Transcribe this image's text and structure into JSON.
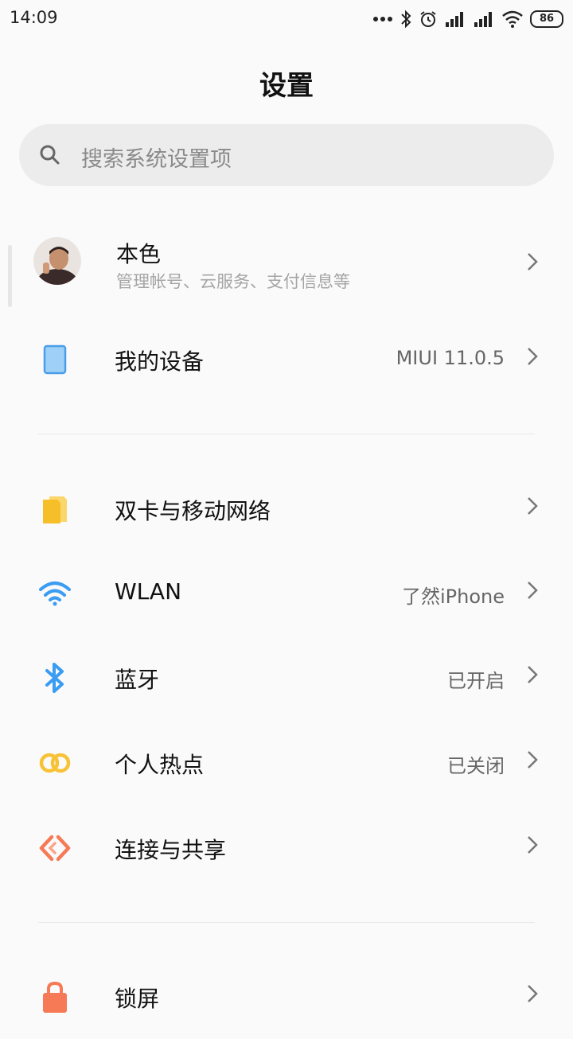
{
  "status_bar": {
    "time": "14:09",
    "icons": [
      "more-dots-icon",
      "bluetooth-icon",
      "alarm-icon",
      "signal-icon",
      "signal-icon",
      "wifi-icon"
    ],
    "battery": "86"
  },
  "page": {
    "title": "设置"
  },
  "search": {
    "placeholder": "搜索系统设置项"
  },
  "account": {
    "name": "本色",
    "subtitle": "管理帐号、云服务、支付信息等"
  },
  "sections": [
    {
      "items": [
        {
          "label": "我的设备",
          "value": "MIUI 11.0.5",
          "icon": "tablet-icon",
          "icon_color": "#5aaef0"
        }
      ]
    },
    {
      "items": [
        {
          "label": "双卡与移动网络",
          "value": "",
          "icon": "sim-card-icon",
          "icon_color": "#f8c236"
        },
        {
          "label": "WLAN",
          "value": "了然iPhone",
          "icon": "wifi-icon",
          "icon_color": "#3a9cf2"
        },
        {
          "label": "蓝牙",
          "value": "已开启",
          "icon": "bluetooth-icon",
          "icon_color": "#3a9cf2"
        },
        {
          "label": "个人热点",
          "value": "已关闭",
          "icon": "hotspot-icon",
          "icon_color": "#f8c236"
        },
        {
          "label": "连接与共享",
          "value": "",
          "icon": "share-connect-icon",
          "icon_color": "#f57a55"
        }
      ]
    },
    {
      "items": [
        {
          "label": "锁屏",
          "value": "",
          "icon": "lock-icon",
          "icon_color": "#f57a55"
        }
      ]
    }
  ]
}
